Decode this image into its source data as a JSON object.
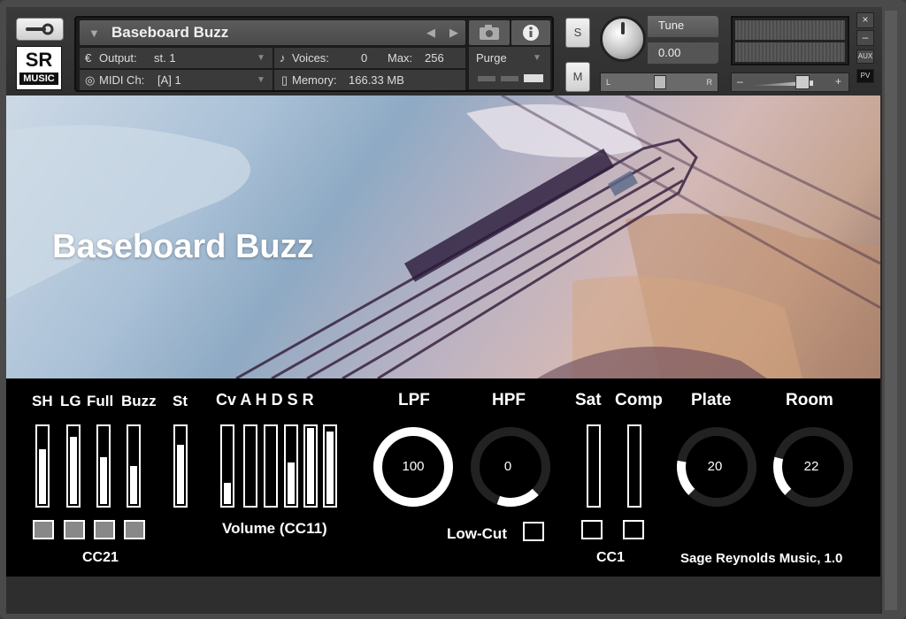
{
  "instrument": {
    "title": "Baseboard Buzz",
    "output_label": "Output:",
    "output_value": "st. 1",
    "midi_label": "MIDI Ch:",
    "midi_value": "[A] 1",
    "voices_label": "Voices:",
    "voices_value": "0",
    "max_label": "Max:",
    "max_value": "256",
    "memory_label": "Memory:",
    "memory_value": "166.33 MB",
    "purge_label": "Purge",
    "solo_label": "S",
    "mute_label": "M",
    "tune_label": "Tune",
    "tune_value": "0.00",
    "pan_left": "L",
    "pan_right": "R",
    "aux_label": "AUX",
    "pv_label": "PV",
    "close_label": "×",
    "minimize_label": "–"
  },
  "logo": {
    "line1": "SR",
    "line2": "MUSIC"
  },
  "artwork": {
    "title": "Baseboard Buzz"
  },
  "controls": {
    "articulations": [
      {
        "label": "SH",
        "level": 0.72
      },
      {
        "label": "LG",
        "level": 0.88
      },
      {
        "label": "Full",
        "level": 0.62
      },
      {
        "label": "Buzz",
        "level": 0.5
      }
    ],
    "st": {
      "label": "St",
      "level": 0.78
    },
    "cc21_label": "CC21",
    "envelope_label": "Cv A H D S R",
    "envelope": [
      {
        "label": "Cv",
        "level": 0.28
      },
      {
        "label": "A",
        "level": 0.0
      },
      {
        "label": "H",
        "level": 0.0
      },
      {
        "label": "D",
        "level": 0.55
      },
      {
        "label": "S",
        "level": 1.0
      },
      {
        "label": "R",
        "level": 0.95
      }
    ],
    "volume_label": "Volume (CC11)",
    "lpf": {
      "label": "LPF",
      "value": "100",
      "level": 1.0
    },
    "hpf": {
      "label": "HPF",
      "value": "0",
      "level": 0.0
    },
    "lowcut_label": "Low-Cut",
    "sat": {
      "label": "Sat",
      "level": 0.0
    },
    "comp": {
      "label": "Comp",
      "level": 0.0
    },
    "cc1_label": "CC1",
    "plate": {
      "label": "Plate",
      "value": "20",
      "level": 0.2
    },
    "room": {
      "label": "Room",
      "value": "22",
      "level": 0.22
    },
    "credit": "Sage Reynolds Music, 1.0"
  }
}
